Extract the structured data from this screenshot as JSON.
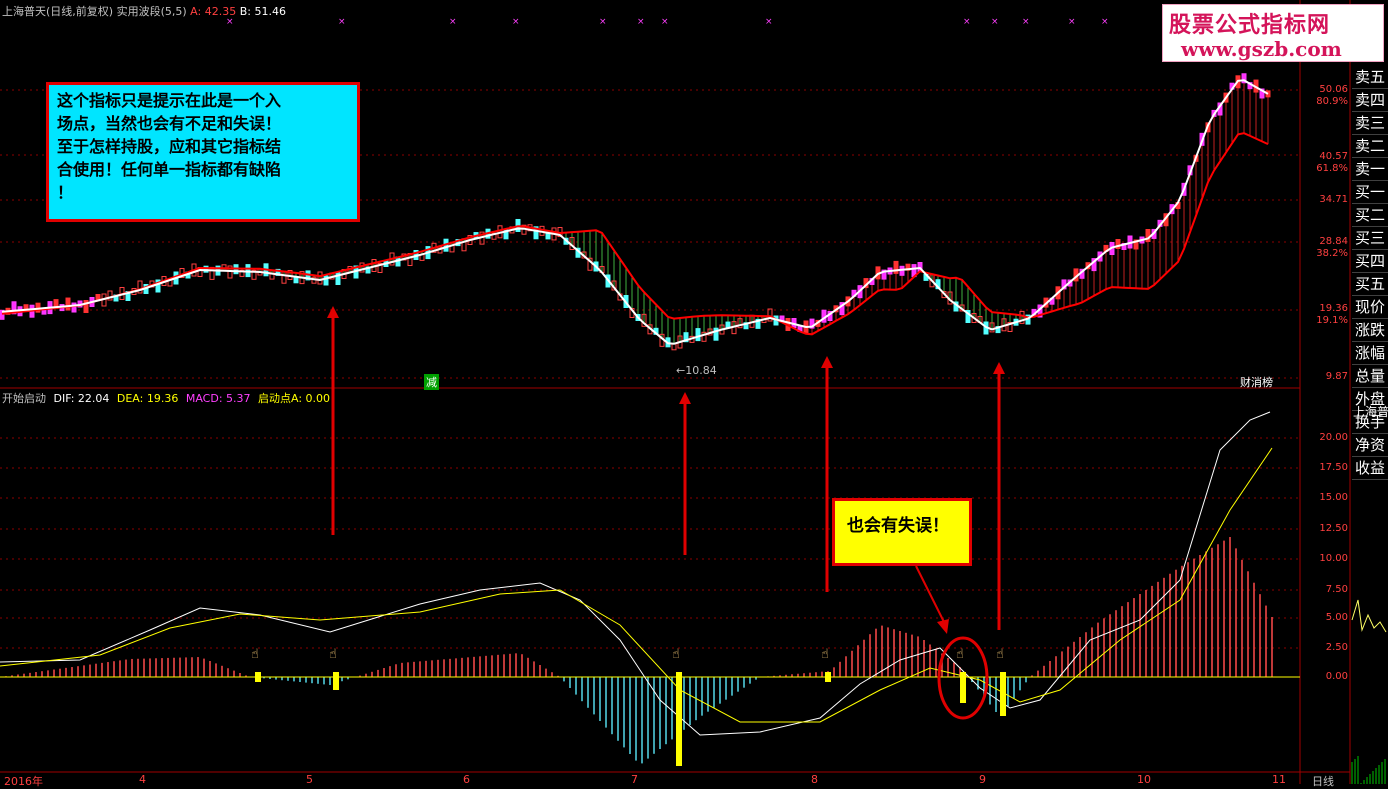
{
  "header": {
    "stock": "上海普天(日线,前复权)",
    "indicator": "实用波段(5,5)",
    "a_label": "A: 42.35",
    "b_label": "B: 51.46"
  },
  "watermark": {
    "line1": "股票公式指标网",
    "line2": "www.gszb.com"
  },
  "note_main": [
    "这个指标只是提示在此是一个入",
    "场点，当然也会有不足和失误！",
    "至于怎样持股，应和其它指标结",
    "合使用！任何单一指标都有缺陷",
    "！"
  ],
  "note_fail": "也会有失误！",
  "low_marker": "←10.84",
  "badge_left": "减",
  "badge_right": "财消榜",
  "price_axis": {
    "labels": [
      "50.06",
      "80.9%",
      "40.57",
      "61.8%",
      "34.71",
      "28.84",
      "38.2%",
      "19.36",
      "19.1%",
      "9.87"
    ]
  },
  "indicator_header": {
    "name": "开始启动",
    "dif": "DIF: 22.04",
    "dea": "DEA: 19.36",
    "macd": "MACD: 5.37",
    "start": "启动点A: 0.00"
  },
  "macd_axis": [
    "20.00",
    "17.50",
    "15.00",
    "12.50",
    "10.00",
    "7.50",
    "5.00",
    "2.50",
    "0.00"
  ],
  "side_panel": [
    "卖五",
    "卖四",
    "卖三",
    "卖二",
    "卖一",
    "买一",
    "买二",
    "买三",
    "买四",
    "买五",
    "现价",
    "涨跌",
    "涨幅",
    "总量",
    "外盘",
    "换手",
    "净资",
    "收益"
  ],
  "side_panel_bottom": "上海普",
  "time_axis": {
    "labels": [
      "2016年",
      "4",
      "5",
      "6",
      "7",
      "8",
      "9",
      "10",
      "11"
    ],
    "period": "日线"
  },
  "colors": {
    "up": "#ff3232",
    "down": "#54ffff",
    "ma": "#ffffff",
    "band_up": "#ff0000",
    "band_dn": "#00cc00",
    "dif": "#ffffff",
    "dea": "#ffff00",
    "arrow": "#e00000",
    "grid": "#8b0000"
  }
}
